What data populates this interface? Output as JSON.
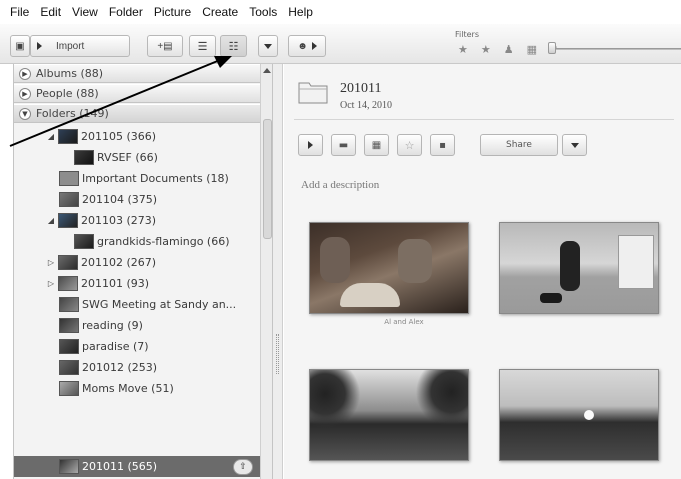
{
  "menu": [
    "File",
    "Edit",
    "View",
    "Folder",
    "Picture",
    "Create",
    "Tools",
    "Help"
  ],
  "toolbar": {
    "import_label": "Import",
    "filters_label": "Filters",
    "filter_icons": [
      "star-icon",
      "star-outline-icon",
      "person-icon",
      "film-icon",
      "upload-icon"
    ]
  },
  "sidebar": {
    "sections": [
      {
        "label": "Albums (88)"
      },
      {
        "label": "People (88)"
      },
      {
        "label": "Folders (149)"
      }
    ],
    "items": [
      {
        "label": "201105 (366)",
        "expander": "◢"
      },
      {
        "label": "RVSEF (66)",
        "expander": ""
      },
      {
        "label": "Important Documents (18)",
        "expander": ""
      },
      {
        "label": "201104 (375)",
        "expander": ""
      },
      {
        "label": "201103 (273)",
        "expander": "◢"
      },
      {
        "label": "grandkids-flamingo (66)",
        "expander": ""
      },
      {
        "label": "201102 (267)",
        "expander": "▷"
      },
      {
        "label": "201101 (93)",
        "expander": "▷"
      },
      {
        "label": "SWG Meeting at Sandy an...",
        "expander": ""
      },
      {
        "label": "reading (9)",
        "expander": ""
      },
      {
        "label": "paradise (7)",
        "expander": ""
      },
      {
        "label": "201012 (253)",
        "expander": ""
      },
      {
        "label": "Moms Move (51)",
        "expander": ""
      },
      {
        "label": "201011 (565)",
        "expander": "",
        "selected": true
      }
    ]
  },
  "main": {
    "folder_name": "201011",
    "folder_date": "Oct 14, 2010",
    "share_label": "Share",
    "description_placeholder": "Add a description",
    "photo_caption": "Al and Alex"
  },
  "colors": {
    "selected_row": "#6b6b6b",
    "panel_bg": "#f3f3f3",
    "arrow": "#000000"
  }
}
